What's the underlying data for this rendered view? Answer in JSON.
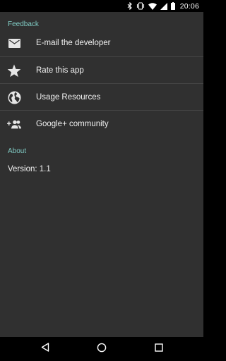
{
  "status_bar": {
    "time": "20:06",
    "icons": [
      "bluetooth-icon",
      "vibrate-icon",
      "wifi-icon",
      "cell-signal-icon",
      "battery-icon"
    ]
  },
  "sections": {
    "feedback": {
      "header": "Feedback",
      "items": [
        {
          "icon": "email-icon",
          "label": "E-mail the developer"
        },
        {
          "icon": "star-icon",
          "label": "Rate this app"
        },
        {
          "icon": "globe-icon",
          "label": "Usage Resources"
        },
        {
          "icon": "group-add-icon",
          "label": "Google+ community"
        }
      ]
    },
    "about": {
      "header": "About",
      "version": "Version: 1.1"
    }
  },
  "nav_bar": {
    "buttons": [
      "back-icon",
      "home-icon",
      "recents-icon"
    ]
  },
  "colors": {
    "background": "#303030",
    "accent": "#80cbc4",
    "text": "#f2f2f2",
    "divider": "#454545"
  }
}
